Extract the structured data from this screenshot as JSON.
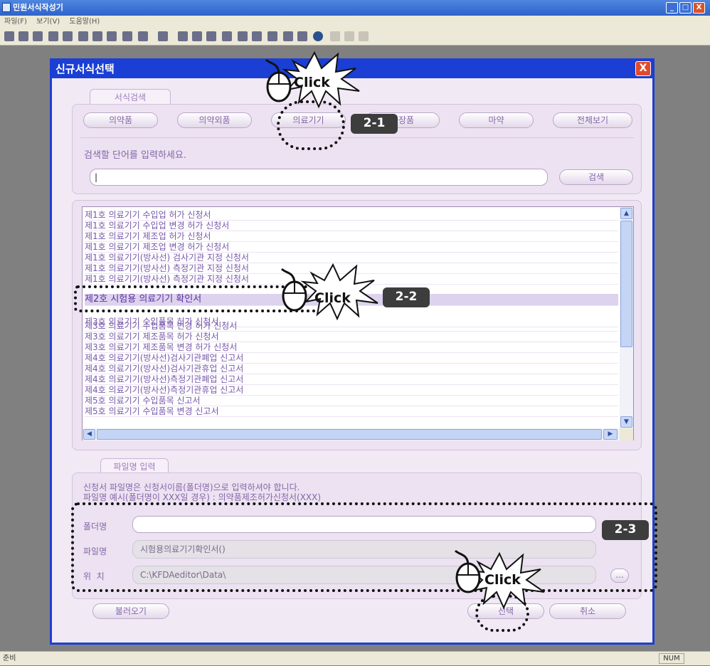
{
  "app": {
    "title": "민원서식작성기",
    "menu": [
      "파일(F)",
      "보기(V)",
      "도움말(H)"
    ],
    "status_left": "준비",
    "status_right": "NUM",
    "window_buttons": [
      "_",
      "□",
      "X"
    ]
  },
  "dialog": {
    "title": "신규서식선택",
    "close": "X",
    "search_section": {
      "tab": "서식검색",
      "categories": [
        "의약품",
        "의약외품",
        "의료기기",
        "화장품",
        "마약",
        "전체보기"
      ],
      "prompt": "검색할 단어를 입력하세요.",
      "input_value": "|",
      "search_button": "검색"
    },
    "list": {
      "items": [
        "제1호 의료기기 수입업 허가 신청서",
        "제1호 의료기기 수입업 변경 허가 신청서",
        "제1호 의료기기 제조업 허가 신청서",
        "제1호 의료기기 제조업 변경 허가 신청서",
        "제1호 의료기기(방사선) 검사기관 지정 신청서",
        "제1호 의료기기(방사선) 측정기관 지정 신청서",
        "제1호 의료기기(방사선) 측정기관 지정 신청서",
        "제2호 시험용 의료기기 확인서",
        "제3호 의료기기 수입품목 허가 신청서",
        "제3호 의료기기 수입품목 변경 허가 신청서",
        "제3호 의료기기 제조품목 허가 신청서",
        "제3호 의료기기 제조품목 변경 허가 신청서",
        "제4호 의료기기(방사선)검사기관폐업 신고서",
        "제4호 의료기기(방사선)검사기관휴업 신고서",
        "제4호 의료기기(방사선)측정기관폐업 신고서",
        "제4호 의료기기(방사선)측정기관휴업 신고서",
        "제5호 의료기기 수입품목 신고서",
        "제5호 의료기기 수입품목 변경 신고서"
      ],
      "selected_index": 7
    },
    "file_section": {
      "tab": "파일명 입력",
      "notice_line1": "신청서 파일명은 신청서이름(폴더명)으로 입력하셔야 합니다.",
      "notice_line2": "파일명 예시(폴더명이 XXX일 경우) : 의약품제조허가신청서(XXX)",
      "folder_label": "폴더명",
      "folder_value": "",
      "filename_label": "파일명",
      "filename_value": "시험용의료기기확인서()",
      "location_label": "위  치",
      "location_value": "C:\\KFDAeditor\\Data\\",
      "browse_button": "..."
    },
    "buttons": {
      "load": "불러오기",
      "select": "선택",
      "cancel": "취소"
    }
  },
  "annotations": {
    "click_text": "Click",
    "step1": "2-1",
    "step2": "2-2",
    "step3": "2-3"
  }
}
